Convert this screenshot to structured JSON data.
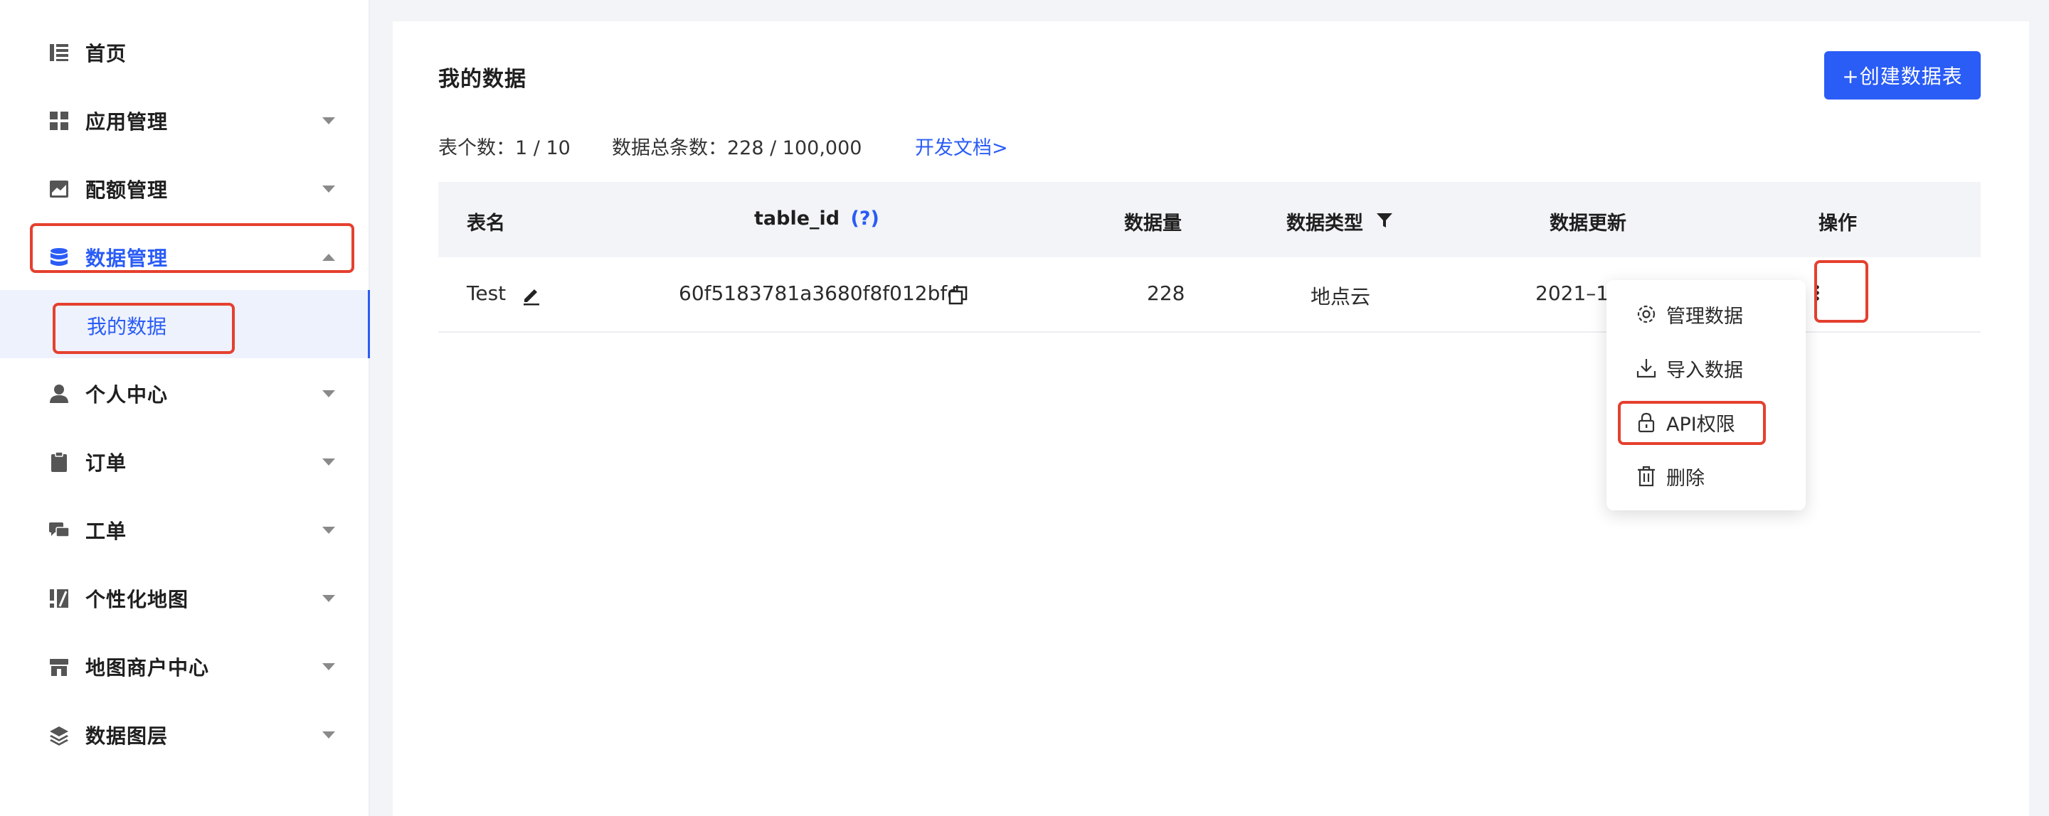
{
  "sidebar": {
    "items": [
      {
        "label": "首页"
      },
      {
        "label": "应用管理"
      },
      {
        "label": "配额管理"
      },
      {
        "label": "数据管理"
      },
      {
        "label": "个人中心"
      },
      {
        "label": "订单"
      },
      {
        "label": "工单"
      },
      {
        "label": "个性化地图"
      },
      {
        "label": "地图商户中心"
      },
      {
        "label": "数据图层"
      }
    ],
    "sub_item": {
      "label": "我的数据"
    }
  },
  "main": {
    "title": "我的数据",
    "create_button": "+创建数据表",
    "stats": {
      "table_count": "表个数：1 / 10",
      "data_total": "数据总条数：228 / 100,000",
      "docs_link": "开发文档>"
    },
    "table": {
      "headers": {
        "name": "表名",
        "table_id": "table_id",
        "table_id_help": "(?)",
        "count": "数据量",
        "type": "数据类型",
        "updated": "数据更新",
        "actions": "操作"
      },
      "rows": [
        {
          "name": "Test",
          "table_id": "60f5183781a3680f8f012bfd",
          "count": "228",
          "type": "地点云",
          "updated": "2021–11"
        }
      ]
    },
    "dropdown": {
      "items": [
        {
          "label": "管理数据",
          "icon": "gear-icon"
        },
        {
          "label": "导入数据",
          "icon": "download-icon"
        },
        {
          "label": "API权限",
          "icon": "lock-icon"
        },
        {
          "label": "删除",
          "icon": "trash-icon"
        }
      ]
    }
  },
  "colors": {
    "accent": "#2a5cf6",
    "highlight": "#e5402f",
    "header_bg": "#f3f4f7"
  }
}
